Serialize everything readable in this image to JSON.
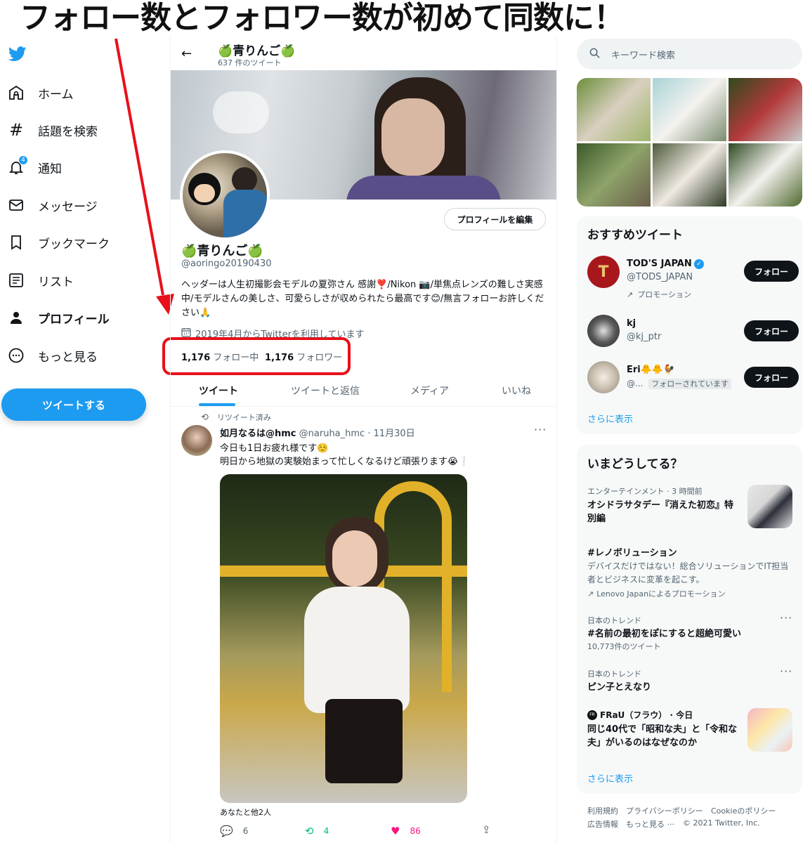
{
  "headline": "フォロー数とフォロワー数が初めて同数に！",
  "nav": {
    "items": [
      {
        "label": "ホーム"
      },
      {
        "label": "話題を検索"
      },
      {
        "label": "通知",
        "badge": "4"
      },
      {
        "label": "メッセージ"
      },
      {
        "label": "ブックマーク"
      },
      {
        "label": "リスト"
      },
      {
        "label": "プロフィール"
      },
      {
        "label": "もっと見る"
      }
    ],
    "tweet_button": "ツイートする"
  },
  "profile": {
    "header_name": "🍏青りんご🍏",
    "tweet_count": "637 件のツイート",
    "edit_button": "プロフィールを編集",
    "name": "🍏青りんご🍏",
    "handle": "@aoringo20190430",
    "bio": "ヘッダーは人生初撮影会モデルの夏弥さん 感謝❣️/Nikon 📷/単焦点レンズの難しさ実感中/モデルさんの美しさ、可愛らしさが収められたら最高です😊/無言フォローお許しください🙏",
    "joined": "2019年4月からTwitterを利用しています",
    "following_count": "1,176",
    "following_label": "フォロー中",
    "followers_count": "1,176",
    "followers_label": "フォロワー"
  },
  "tabs": [
    "ツイート",
    "ツイートと返信",
    "メディア",
    "いいね"
  ],
  "tweet": {
    "retweet_label": "リツイート済み",
    "author": "如月なるは@hmc",
    "handle_date": "@naruha_hmc · 11月30日",
    "line1": "今日も1日お疲れ様です☺️",
    "line2": "明日から地獄の実験始まって忙しくなるけど頑張ります😭❕",
    "liked_by": "あなたと他2人",
    "replies": "6",
    "retweets": "4",
    "likes": "86"
  },
  "right": {
    "search_placeholder": "キーワード検索",
    "recommended_title": "おすすめツイート",
    "recommendations": [
      {
        "name": "TOD'S JAPAN",
        "handle": "@TODS_JAPAN",
        "note": "プロモーション",
        "button": "フォロー"
      },
      {
        "name": "kj",
        "handle": "@kj_ptr",
        "button": "フォロー"
      },
      {
        "name": "Eri🐥🐥🐓",
        "handle": "@...",
        "note": "フォローされています",
        "button": "フォロー"
      }
    ],
    "show_more": "さらに表示",
    "trends_title": "いまどうしてる？",
    "trends": [
      {
        "meta": "エンターテインメント · 3 時間前",
        "title": "オシドラサタデー『消えた初恋』特別編"
      },
      {
        "title": "#レノボリューション",
        "desc": "デバイスだけではない！総合ソリューションでIT担当者とビジネスに変革を起こす。",
        "promo": "Lenovo Japanによるプロモーション"
      },
      {
        "meta": "日本のトレンド",
        "title": "#名前の最初をぽにすると超絶可愛い",
        "count": "10,773件のツイート"
      },
      {
        "meta": "日本のトレンド",
        "title": "ピン子とえなり"
      },
      {
        "meta": "FRaU（フラウ） · 今日",
        "title": "同じ40代で「昭和な夫」と「令和な夫」がいるのはなぜなのか"
      }
    ],
    "show_more2": "さらに表示",
    "footer": [
      "利用規約",
      "プライバシーポリシー",
      "Cookieのポリシー",
      "広告情報",
      "もっと見る ···",
      "© 2021 Twitter, Inc."
    ]
  },
  "colors": {
    "accent": "#1d9bf0",
    "annotation": "#e8101a",
    "like": "#f91880",
    "retweet": "#00ba7c"
  }
}
